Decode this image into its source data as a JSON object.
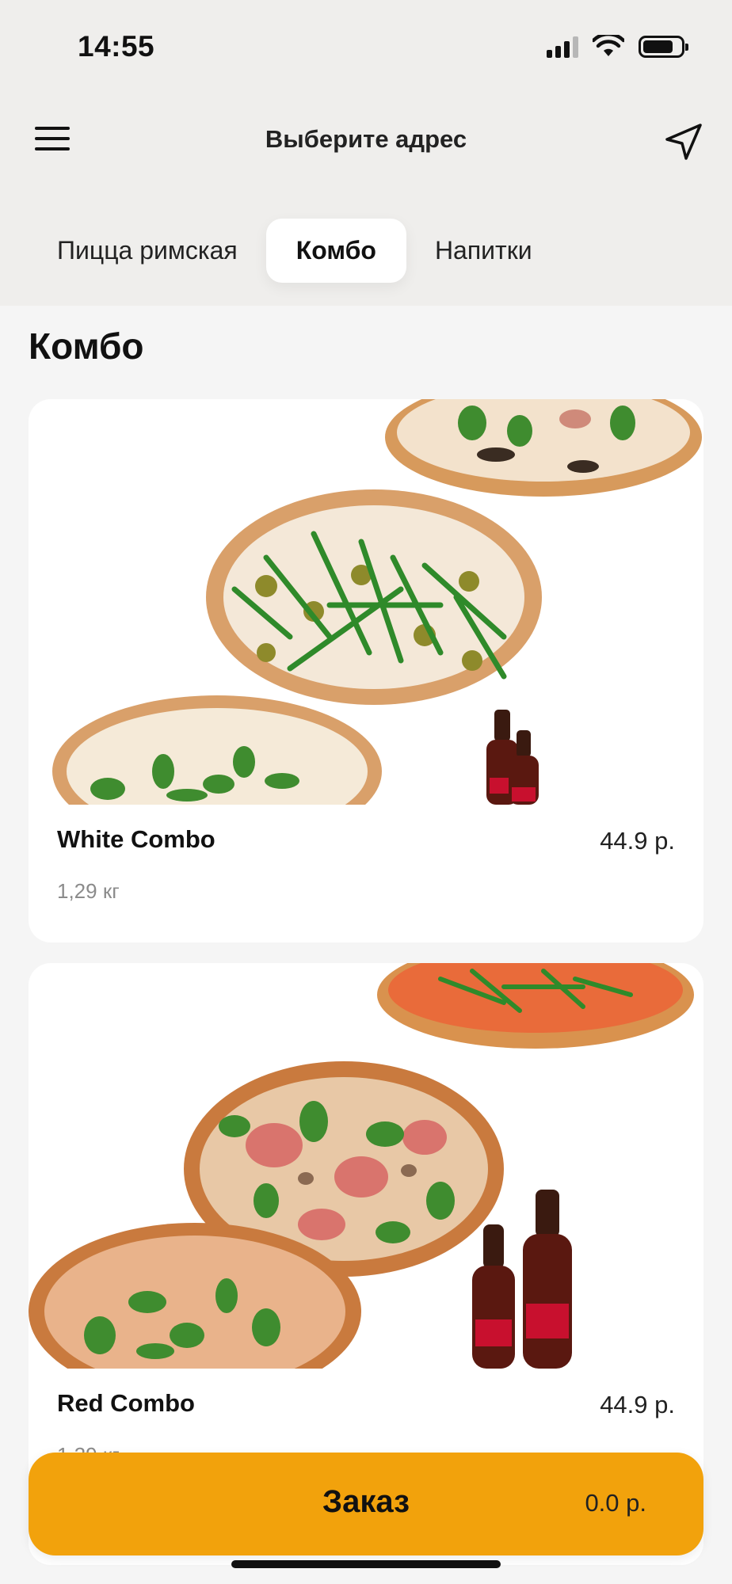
{
  "status_bar": {
    "time": "14:55"
  },
  "header": {
    "menu_icon": "hamburger-menu-icon",
    "address_label": "Выберите адрес",
    "location_icon": "navigation-arrow-icon"
  },
  "tabs": [
    {
      "label": "Пицца римская",
      "active": false
    },
    {
      "label": "Комбо",
      "active": true
    },
    {
      "label": "Напитки",
      "active": false
    }
  ],
  "section": {
    "title": "Комбо"
  },
  "products": [
    {
      "name": "White Combo",
      "price": "44.9 р.",
      "weight": "1,29 кг",
      "image": "white-combo-pizzas-and-cola-image"
    },
    {
      "name": "Red Combo",
      "price": "44.9 р.",
      "weight": "1,29 кг",
      "image": "red-combo-pizzas-and-cola-image"
    }
  ],
  "order_bar": {
    "label": "Заказ",
    "total": "0.0 р."
  },
  "colors": {
    "accent": "#f2a20c",
    "header_bg": "#efeeec",
    "page_bg": "#f5f5f5",
    "card_bg": "#ffffff"
  }
}
